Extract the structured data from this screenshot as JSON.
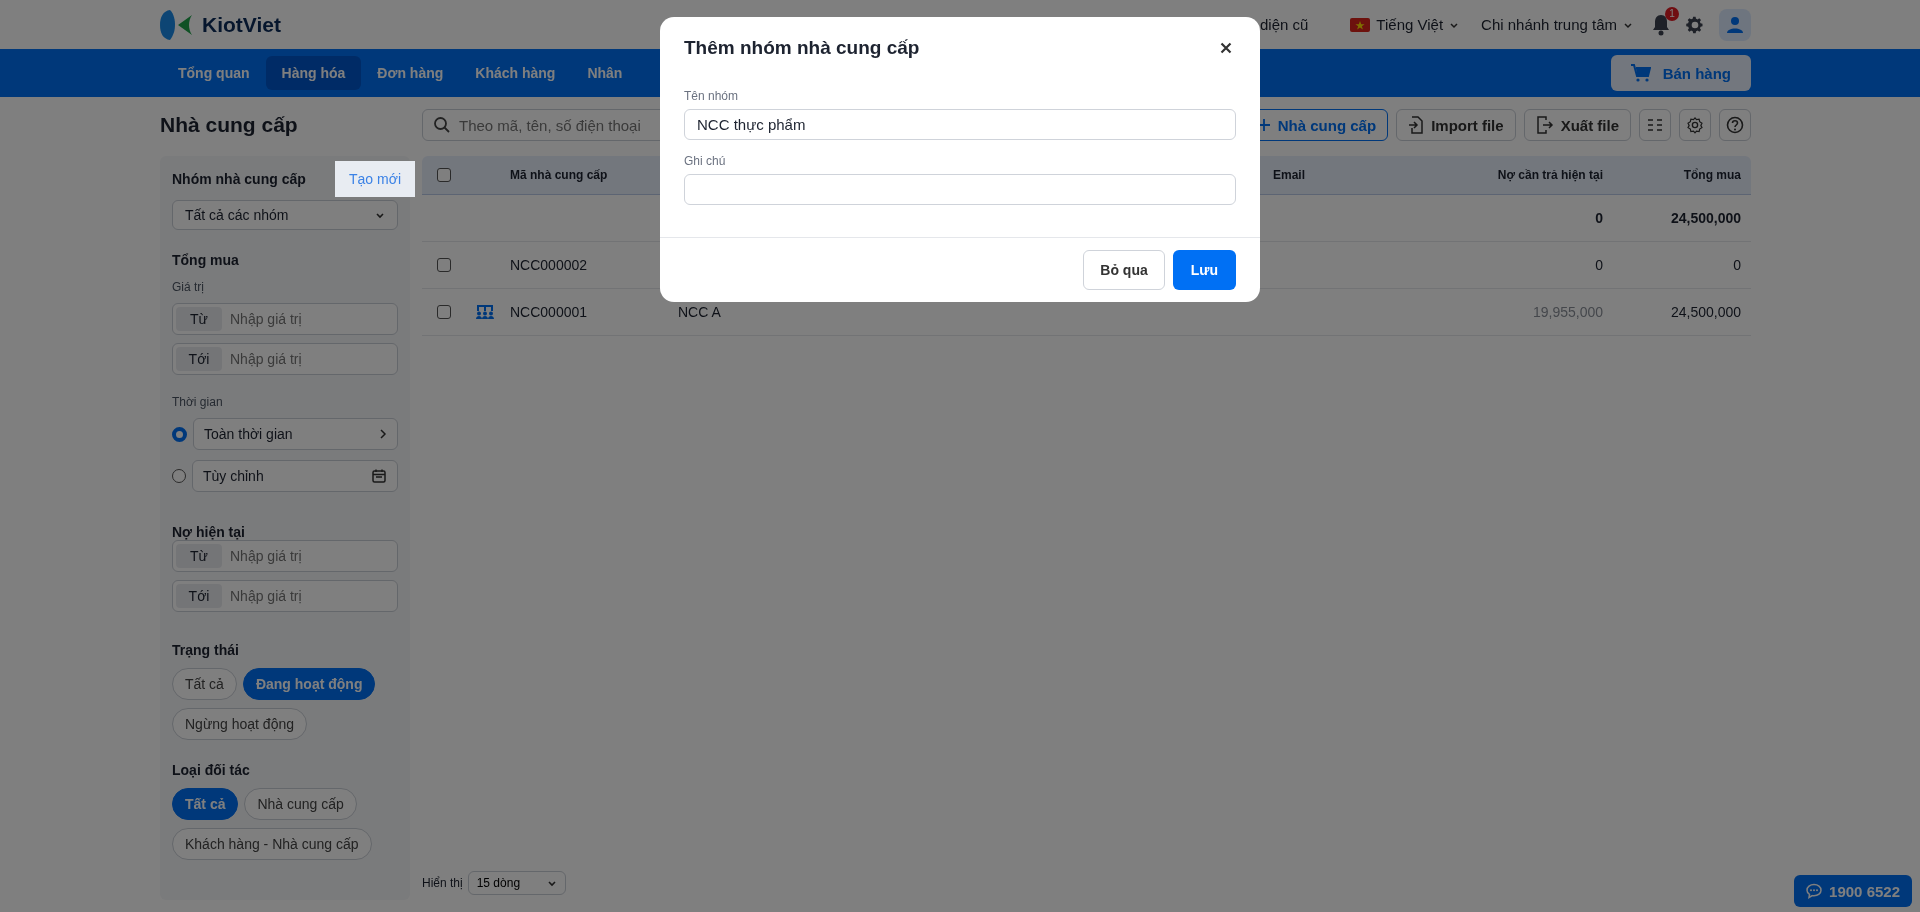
{
  "top_bar": {
    "logo_text": "KiotViet",
    "old_interface_link": "diện cũ",
    "language": "Tiếng Việt",
    "branch": "Chi nhánh trung tâm",
    "notification_count": "1"
  },
  "nav": {
    "items": [
      {
        "label": "Tổng quan",
        "selected": false
      },
      {
        "label": "Hàng hóa",
        "selected": true
      },
      {
        "label": "Đơn hàng",
        "selected": false
      },
      {
        "label": "Khách hàng",
        "selected": false
      },
      {
        "label": "Nhân",
        "selected": false
      }
    ],
    "sell_button": "Bán hàng"
  },
  "page_title": "Nhà cung cấp",
  "toolbar": {
    "search_placeholder": "Theo mã, tên, số điện thoại",
    "add_button": "Nhà cung cấp",
    "import_button": "Import file",
    "export_button": "Xuất file"
  },
  "sidebar": {
    "group": {
      "title": "Nhóm nhà cung cấp",
      "create_link": "Tạo mới",
      "select": "Tất cả các nhóm"
    },
    "total_purchase": {
      "title": "Tổng mua",
      "value_label": "Giá trị",
      "ranges": [
        {
          "prefix": "Từ",
          "placeholder": "Nhập giá trị"
        },
        {
          "prefix": "Tới",
          "placeholder": "Nhập giá trị"
        }
      ],
      "time_label": "Thời gian",
      "time_options": [
        {
          "label": "Toàn thời gian",
          "selected": true,
          "kind": "preset"
        },
        {
          "label": "Tùy chỉnh",
          "selected": false,
          "kind": "custom"
        }
      ]
    },
    "debt": {
      "title": "Nợ hiện tại",
      "ranges": [
        {
          "prefix": "Từ",
          "placeholder": "Nhập giá trị"
        },
        {
          "prefix": "Tới",
          "placeholder": "Nhập giá trị"
        }
      ]
    },
    "status": {
      "title": "Trạng thái",
      "options": [
        {
          "label": "Tất cả",
          "selected": false
        },
        {
          "label": "Đang hoạt động",
          "selected": true
        },
        {
          "label": "Ngừng hoạt động",
          "selected": false
        }
      ]
    },
    "partner_type": {
      "title": "Loại đối tác",
      "options": [
        {
          "label": "Tất cả",
          "selected": true
        },
        {
          "label": "Nhà cung cấp",
          "selected": false
        },
        {
          "label": "Khách hàng - Nhà cung cấp",
          "selected": false
        }
      ]
    }
  },
  "table": {
    "columns": {
      "code": "Mã nhà cung cấp",
      "email": "Email",
      "debt": "Nợ cần trả hiện tại",
      "total": "Tổng mua"
    },
    "select_all_checked": false,
    "summary": {
      "debt": "0",
      "total": "24,500,000"
    },
    "rows": [
      {
        "checked": false,
        "show_icon": false,
        "code": "NCC000002",
        "debt": "0",
        "debt_muted": false,
        "total": "0"
      },
      {
        "checked": false,
        "show_icon": true,
        "code": "NCC000001",
        "name": "NCC A",
        "debt": "19,955,000",
        "debt_muted": true,
        "total": "24,500,000"
      }
    ]
  },
  "footer": {
    "show_label": "Hiển thị",
    "page_size": "15 dòng"
  },
  "hotline": "1900 6522",
  "modal": {
    "title": "Thêm nhóm nhà cung cấp",
    "fields": [
      {
        "label": "Tên nhóm",
        "value": "NCC thực phẩm"
      },
      {
        "label": "Ghi chú"
      }
    ],
    "cancel_button": "Bỏ qua",
    "save_button": "Lưu"
  }
}
